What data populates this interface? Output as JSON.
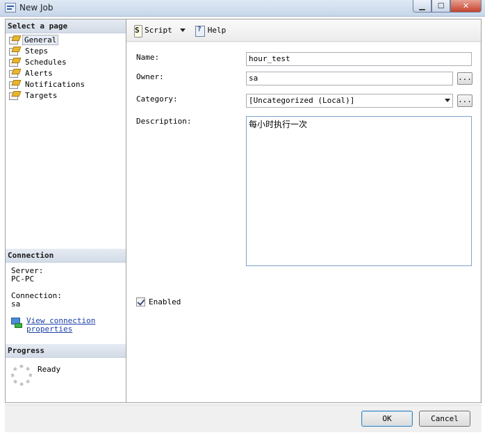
{
  "window": {
    "title": "New Job",
    "minimize": "▁",
    "maximize": "☐",
    "close": "✕"
  },
  "left": {
    "select_page_header": "Select a page",
    "pages": [
      {
        "label": "General",
        "selected": true
      },
      {
        "label": "Steps"
      },
      {
        "label": "Schedules"
      },
      {
        "label": "Alerts"
      },
      {
        "label": "Notifications"
      },
      {
        "label": "Targets"
      }
    ],
    "connection_header": "Connection",
    "server_label": "Server:",
    "server_value": "PC-PC",
    "connection_label": "Connection:",
    "connection_value": "sa",
    "view_link_line1": "View connection",
    "view_link_line2": "properties",
    "progress_header": "Progress",
    "progress_status": "Ready"
  },
  "toolbar": {
    "script_label": "Script",
    "help_label": "Help"
  },
  "form": {
    "name_label": "Name:",
    "name_value": "hour_test",
    "owner_label": "Owner:",
    "owner_value": "sa",
    "category_label": "Category:",
    "category_value": "[Uncategorized (Local)]",
    "description_label": "Description:",
    "description_value": "每小时执行一次",
    "enabled_label": "Enabled",
    "enabled_checked": true,
    "browse_label": "..."
  },
  "buttons": {
    "ok": "OK",
    "cancel": "Cancel"
  }
}
